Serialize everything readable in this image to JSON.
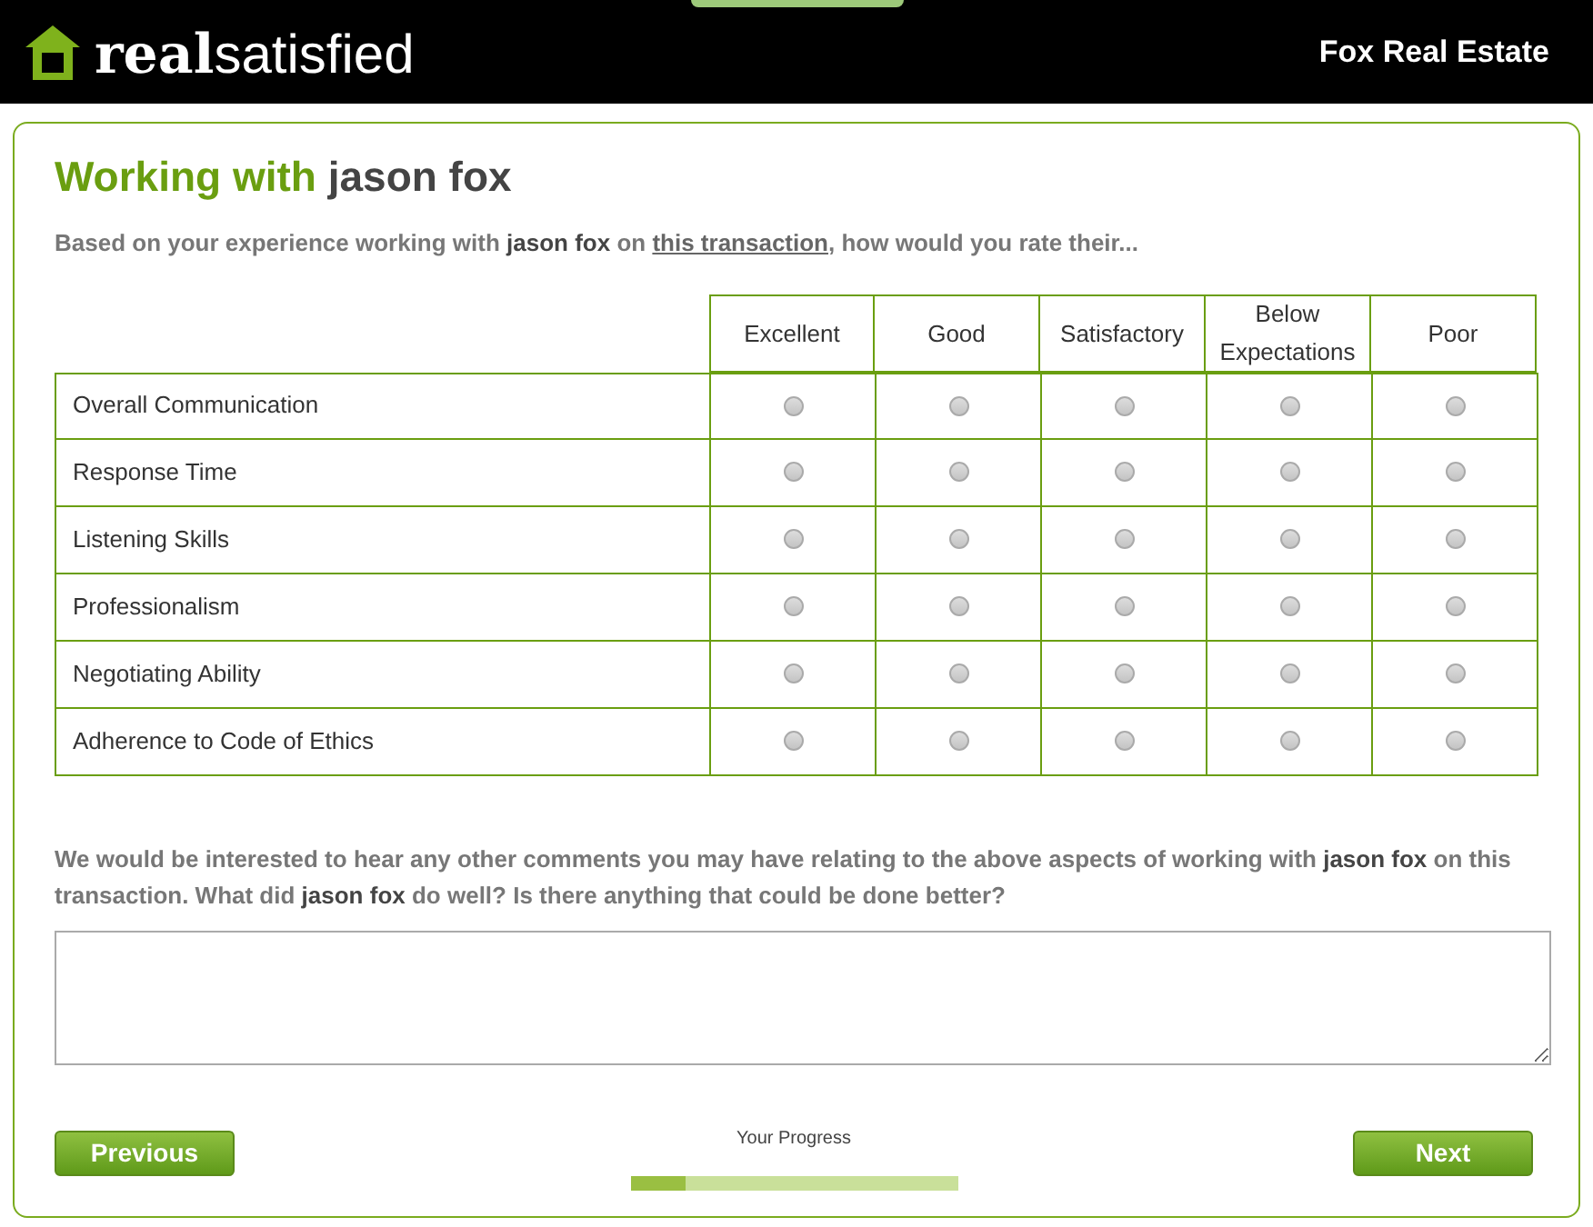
{
  "header": {
    "logo_bold": "real",
    "logo_light": "satisfied",
    "company": "Fox Real Estate"
  },
  "title_prefix": "Working with",
  "title_name": "jason fox",
  "intro": [
    {
      "kind": "text",
      "text": "Based on your experience working with "
    },
    {
      "kind": "bold",
      "text": "jason fox"
    },
    {
      "kind": "text",
      "text": " on "
    },
    {
      "kind": "link",
      "text": "this transaction"
    },
    {
      "kind": "text",
      "text": ", how would you rate their..."
    }
  ],
  "columns": [
    "Excellent",
    "Good",
    "Satisfactory",
    "Below Expectations",
    "Poor"
  ],
  "rows": [
    {
      "label": "Overall Communication",
      "choices": [
        {
          "selected": false
        },
        {
          "selected": false
        },
        {
          "selected": false
        },
        {
          "selected": false
        },
        {
          "selected": false
        }
      ]
    },
    {
      "label": "Response Time",
      "choices": [
        {
          "selected": false
        },
        {
          "selected": false
        },
        {
          "selected": false
        },
        {
          "selected": false
        },
        {
          "selected": false
        }
      ]
    },
    {
      "label": "Listening Skills",
      "choices": [
        {
          "selected": false
        },
        {
          "selected": false
        },
        {
          "selected": false
        },
        {
          "selected": false
        },
        {
          "selected": false
        }
      ]
    },
    {
      "label": "Professionalism",
      "choices": [
        {
          "selected": false
        },
        {
          "selected": false
        },
        {
          "selected": false
        },
        {
          "selected": false
        },
        {
          "selected": false
        }
      ]
    },
    {
      "label": "Negotiating Ability",
      "choices": [
        {
          "selected": false
        },
        {
          "selected": false
        },
        {
          "selected": false
        },
        {
          "selected": false
        },
        {
          "selected": false
        }
      ]
    },
    {
      "label": "Adherence to Code of Ethics",
      "choices": [
        {
          "selected": false
        },
        {
          "selected": false
        },
        {
          "selected": false
        },
        {
          "selected": false
        },
        {
          "selected": false
        }
      ]
    }
  ],
  "comments_prompt": [
    {
      "kind": "text",
      "text": "We would be interested to hear any other comments you may have relating to the above aspects of working with "
    },
    {
      "kind": "bold",
      "text": "jason fox"
    },
    {
      "kind": "text",
      "text": " on this transaction. What did "
    },
    {
      "kind": "bold",
      "text": "jason fox"
    },
    {
      "kind": "text",
      "text": " do well? Is there anything that could be done better?"
    }
  ],
  "footer": {
    "previous": "Previous",
    "progress_label": "Your Progress",
    "progress": {
      "level": 0.17
    },
    "next": "Next"
  }
}
